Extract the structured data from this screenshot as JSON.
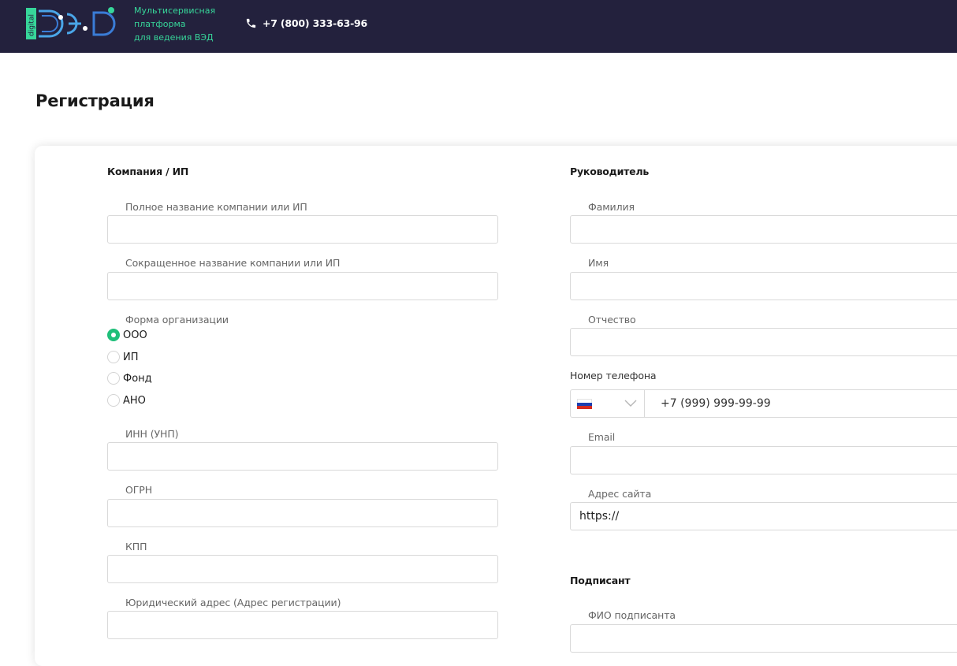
{
  "header": {
    "tagline_lines": [
      "Мультисервисная",
      "платформа",
      "для ведения ВЭД"
    ],
    "phone": "+7 (800) 333-63-96",
    "logo_text": "digital ВЭД",
    "accent_color": "#37d69a",
    "background_color": "#23213d"
  },
  "page": {
    "title": "Регистрация"
  },
  "company": {
    "title": "Компания / ИП",
    "full_name_label": "Полное название компании или ИП",
    "full_name_value": "",
    "short_name_label": "Сокращенное название компании или ИП",
    "short_name_value": "",
    "org_form_label": "Форма организации",
    "org_forms": [
      "ООО",
      "ИП",
      "Фонд",
      "АНО"
    ],
    "org_form_selected": "ООО",
    "inn_label": "ИНН (УНП)",
    "ogrn_label": "ОГРН",
    "kpp_label": "КПП",
    "address_label": "Юридический адрес (Адрес регистрации)"
  },
  "director": {
    "title": "Руководитель",
    "last_name_label": "Фамилия",
    "first_name_label": "Имя",
    "middle_name_label": "Отчество",
    "phone_label": "Номер телефона",
    "phone_placeholder": "+7 (999) 999-99-99",
    "email_label": "Email",
    "site_label": "Адрес сайта",
    "site_value": "https://"
  },
  "signer": {
    "title": "Подписант",
    "fio_label": "ФИО подписанта"
  },
  "colors": {
    "radio_checked": "#1fbf7a",
    "input_border": "#d9d9d9"
  }
}
